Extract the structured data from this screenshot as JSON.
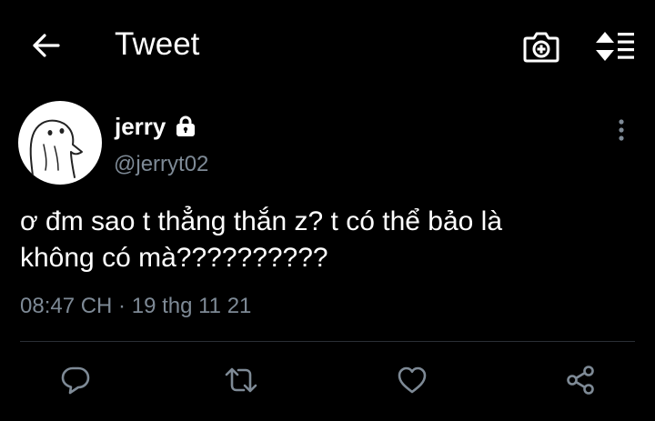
{
  "header": {
    "title": "Tweet",
    "back_icon": "arrow-left-icon",
    "camera_icon": "camera-add-icon",
    "sort_icon": "sort-list-icon"
  },
  "tweet": {
    "author": {
      "display_name": "jerry",
      "handle": "@jerryt02",
      "protected_icon": "lock-icon",
      "avatar_icon": "cartoon-avatar"
    },
    "text_lines": [
      "ơ đm sao t thẳng thắn z? t có thể bảo là",
      "không có mà??????????"
    ],
    "timestamp": "08:47 CH · 19 thg 11 21",
    "more_icon": "more-vertical-icon"
  },
  "actions": [
    {
      "icon": "reply-icon"
    },
    {
      "icon": "retweet-icon"
    },
    {
      "icon": "like-icon"
    },
    {
      "icon": "share-icon"
    }
  ],
  "colors": {
    "background": "#000000",
    "text": "#ffffff",
    "secondary_text": "#7e8a96",
    "divider": "#2a2f35"
  }
}
